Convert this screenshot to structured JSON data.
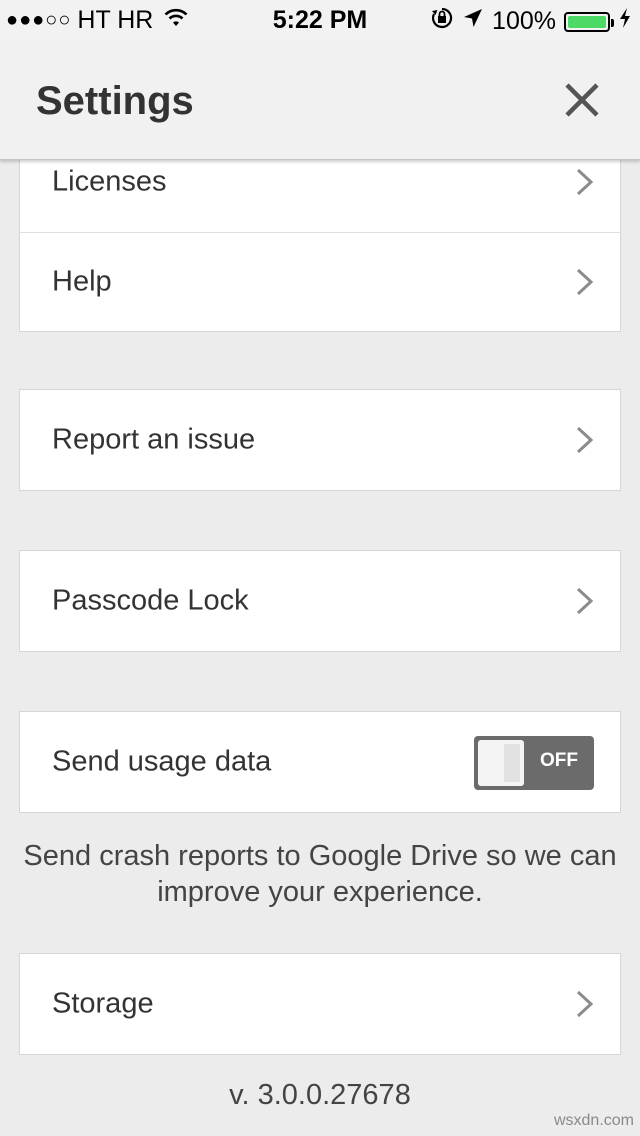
{
  "status_bar": {
    "signal": "●●●○○",
    "carrier": "HT HR",
    "time": "5:22 PM",
    "battery": "100%",
    "battery_level": 1.0,
    "battery_color": "#4cd964"
  },
  "header": {
    "title": "Settings",
    "close_icon": "close-icon"
  },
  "sections": {
    "licenses": "Licenses",
    "help": "Help",
    "report": "Report an issue",
    "passcode": "Passcode Lock",
    "usage": "Send usage data",
    "toggle_state": "OFF",
    "usage_note": "Send crash reports to Google Drive so we can improve your experience.",
    "storage": "Storage"
  },
  "footer": {
    "version": "v. 3.0.0.27678"
  },
  "watermark": "wsxdn.com",
  "colors": {
    "toggle_off": "#6b6b6b",
    "background": "#ececec"
  }
}
